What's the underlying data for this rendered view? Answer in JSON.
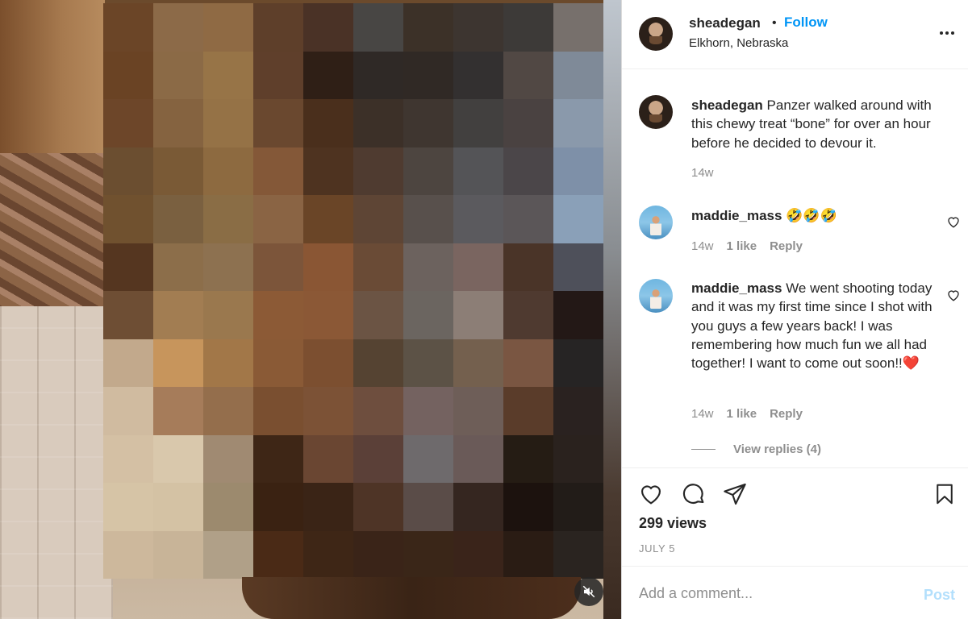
{
  "media": {
    "mosaic_colors": [
      "#6b4527",
      "#8c6a48",
      "#8f6a44",
      "#5e3f2a",
      "#4a3226",
      "#484644",
      "#3c3128",
      "#3d3530",
      "#3d3a38",
      "#77706c",
      "#6a4324",
      "#8b6a46",
      "#977447",
      "#5f3f2b",
      "#2f1f16",
      "#2f2926",
      "#302925",
      "#333030",
      "#514844",
      "#7f8a98",
      "#6d4629",
      "#856340",
      "#957246",
      "#6a482f",
      "#4a2f1c",
      "#3c3028",
      "#3f3630",
      "#42403f",
      "#4a4241",
      "#8a99ab",
      "#6b4e30",
      "#7a5a36",
      "#8d6a40",
      "#845838",
      "#4e3320",
      "#4f3b30",
      "#4d4540",
      "#545457",
      "#4b4649",
      "#7e90a8",
      "#70512f",
      "#7a6040",
      "#8a6d45",
      "#8a6444",
      "#6a4527",
      "#5e4535",
      "#58504c",
      "#5b5a5e",
      "#5b5658",
      "#8aa0b8",
      "#553620",
      "#8c6e4a",
      "#8d7150",
      "#7c553a",
      "#8a5634",
      "#6a4b36",
      "#6c625e",
      "#7a6560",
      "#4a3428",
      "#4e505a",
      "#6e4e34",
      "#a27d52",
      "#9a784e",
      "#8c5a36",
      "#8b5836",
      "#6b5444",
      "#6b6560",
      "#8c7e76",
      "#4f3a30",
      "#231816",
      "#c2a98c",
      "#c7955c",
      "#a27748",
      "#8a5a36",
      "#7c4f30",
      "#554332",
      "#5c5246",
      "#74604e",
      "#7a5642",
      "#262424",
      "#d0bba0",
      "#a67c5a",
      "#946e4c",
      "#7a4f30",
      "#7c5236",
      "#6e4e3e",
      "#746260",
      "#6e5e58",
      "#5a3c2a",
      "#2a2220",
      "#d4c0a4",
      "#d9c8ac",
      "#a08a72",
      "#3e2616",
      "#6a4632",
      "#5b4038",
      "#6e6a6c",
      "#6a5a58",
      "#251c14",
      "#2a221e",
      "#d6c4a6",
      "#d4c2a4",
      "#9c8a6e",
      "#3a2212",
      "#3a2416",
      "#4e3426",
      "#5a4c48",
      "#352620",
      "#1c120e",
      "#221c18",
      "#cdb89c",
      "#c8b498",
      "#b0a088",
      "#4a2a16",
      "#3e2616",
      "#3a2418",
      "#3a2618",
      "#3a241a",
      "#2a1c14",
      "#2a2420"
    ]
  },
  "post": {
    "username": "sheadegan",
    "dot": "•",
    "follow_label": "Follow",
    "location": "Elkhorn, Nebraska",
    "more_icon": "more-horizontal-icon"
  },
  "caption": {
    "username": "sheadegan",
    "text": "Panzer walked around with this chewy treat “bone” for over an hour before he decided to devour it.",
    "age": "14w"
  },
  "comments": [
    {
      "username": "maddie_mass",
      "text": "🤣🤣🤣",
      "age": "14w",
      "likes": "1 like",
      "reply_label": "Reply"
    },
    {
      "username": "maddie_mass",
      "text": "We went shooting today and it was my first time since I shot with you guys a few years back! I was remembering how much fun we all had together! I want to come out soon!!❤️",
      "age": "14w",
      "likes": "1 like",
      "reply_label": "Reply"
    }
  ],
  "view_replies_label": "View replies (4)",
  "stats": {
    "views": "299 views",
    "date": "JULY 5"
  },
  "add_comment": {
    "placeholder": "Add a comment...",
    "post_label": "Post"
  },
  "colors": {
    "accent": "#0095f6",
    "post_disabled": "#b2dffc",
    "text": "#262626",
    "secondary": "#8e8e8e"
  }
}
